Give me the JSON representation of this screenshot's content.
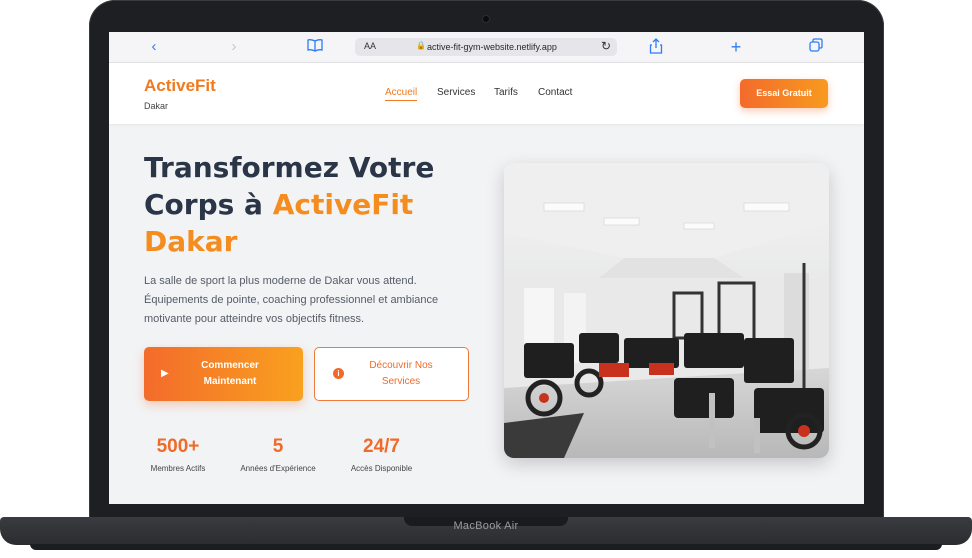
{
  "device": {
    "label": "MacBook Air"
  },
  "browser": {
    "url": "active-fit-gym-website.netlify.app",
    "text_size_label": "AA",
    "icons": [
      "back-icon",
      "forward-icon",
      "book-icon",
      "lock-icon",
      "reload-icon",
      "share-icon",
      "plus-icon",
      "tabs-icon"
    ]
  },
  "site": {
    "logo": "ActiveFit",
    "logo_sub": "Dakar",
    "nav": [
      "Accueil",
      "Services",
      "Tarifs",
      "Contact"
    ],
    "cta": "Essai Gratuit",
    "accent_color": "#f07a1f"
  },
  "hero": {
    "title_1": "Transformez Votre",
    "title_2": "Corps à",
    "title_accent": "ActiveFit Dakar",
    "lead": "La salle de sport la plus moderne de Dakar vous attend. Équipements de pointe, coaching professionnel et ambiance motivante pour atteindre vos objectifs fitness.",
    "primary_button": "Commencer Maintenant",
    "secondary_button": "Découvrir Nos Services",
    "stats": [
      {
        "value": "500+",
        "label": "Membres Actifs"
      },
      {
        "value": "5",
        "label": "Années d'Expérience"
      },
      {
        "value": "24/7",
        "label": "Accès Disponible"
      }
    ]
  }
}
